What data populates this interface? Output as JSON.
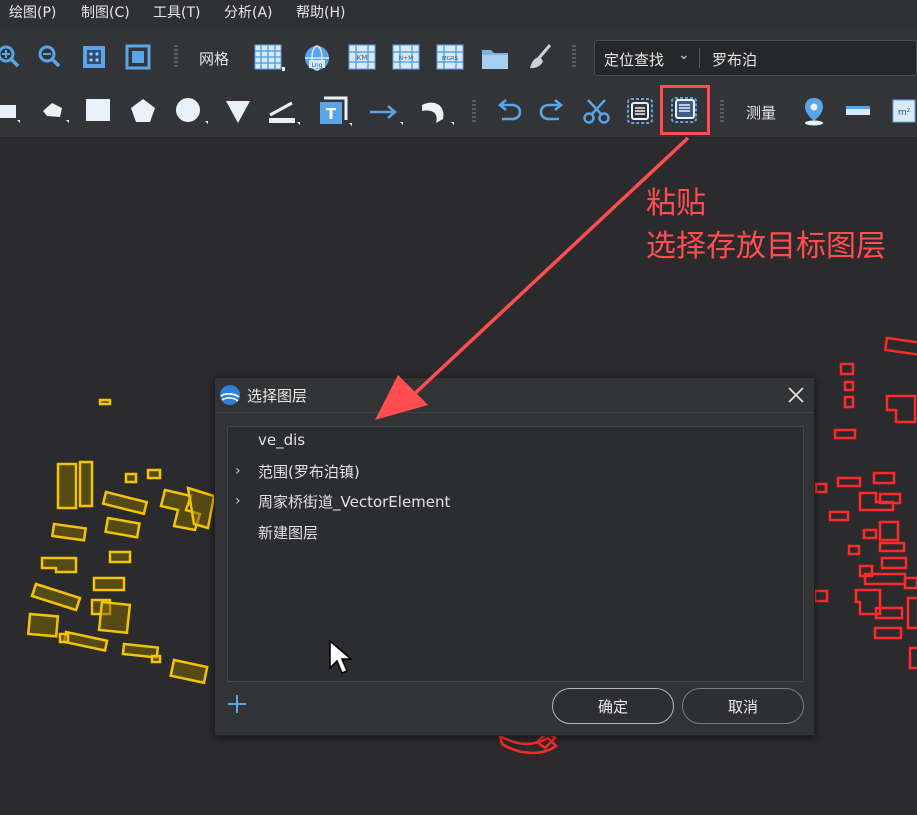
{
  "menubar": {
    "items": [
      "绘图(P)",
      "制图(C)",
      "工具(T)",
      "分析(A)",
      "帮助(H)"
    ]
  },
  "toolbar1": {
    "grid_label": "网格",
    "locate_dropdown": "定位查找",
    "locate_value": "罗布泊"
  },
  "toolbar2": {
    "measure_label": "测量"
  },
  "annotation": {
    "line1": "粘贴",
    "line2": "选择存放目标图层"
  },
  "dialog": {
    "title": "选择图层",
    "layers": [
      {
        "label": "ve_dis",
        "expandable": false
      },
      {
        "label": "范围(罗布泊镇)",
        "expandable": true
      },
      {
        "label": "周家桥街道_VectorElement",
        "expandable": true
      },
      {
        "label": "新建图层",
        "expandable": false
      }
    ],
    "ok_label": "确定",
    "cancel_label": "取消"
  },
  "colors": {
    "annotation": "#ff4d50",
    "highlight_box": "#ff4d50",
    "yellow_features": "#f5c400",
    "red_features": "#ff2a2a",
    "icon_blue": "#5aa4e8"
  }
}
